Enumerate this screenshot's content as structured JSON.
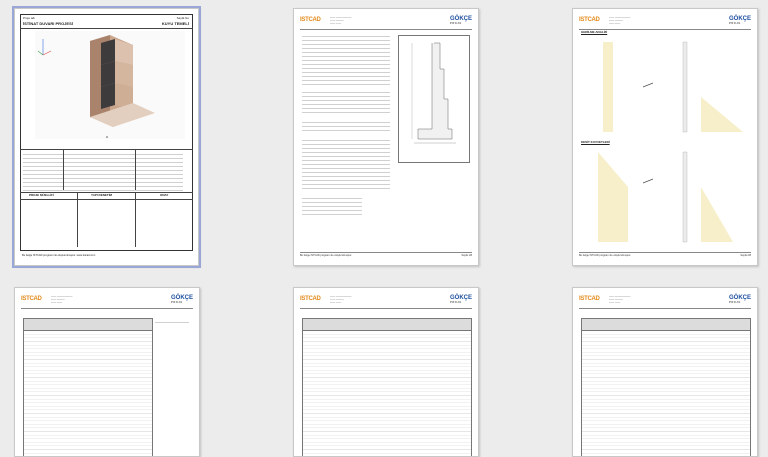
{
  "pages": [
    {
      "id": "p1",
      "header_left": "Proje adı",
      "header_right": "Sayfa No",
      "title": "İSTİNAT DUVARI PROJESİ",
      "title_right": "KUYU TEMELİ",
      "signature_boxes": [
        "PROJE MÜELLİFİ",
        "YAPI DENETİM",
        "ONAY"
      ],
      "footer": "Bu belge ISTCAD programı ile oluşturulmuştur. www.istcad.com"
    },
    {
      "id": "p2",
      "page_label": "Sayfa 1/8"
    },
    {
      "id": "p3",
      "section_1": "GERİLME ANALİZİ",
      "section_2": "KESİT KUVVETLERİ",
      "page_label": "Sayfa 2/8"
    },
    {
      "id": "p4",
      "section": "TABLO"
    },
    {
      "id": "p5",
      "section": "TABLO"
    },
    {
      "id": "p6",
      "section": "TABLO"
    }
  ],
  "logos": {
    "left_main": "IST",
    "left_accent": "CAD",
    "right_main": "GÖKÇE",
    "right_sub": "PROJE"
  },
  "colors": {
    "selection": "#9aa7d6",
    "page_border": "#c8c8c8",
    "logo_blue": "#1d4fa0",
    "logo_orange": "#e38a1c"
  }
}
